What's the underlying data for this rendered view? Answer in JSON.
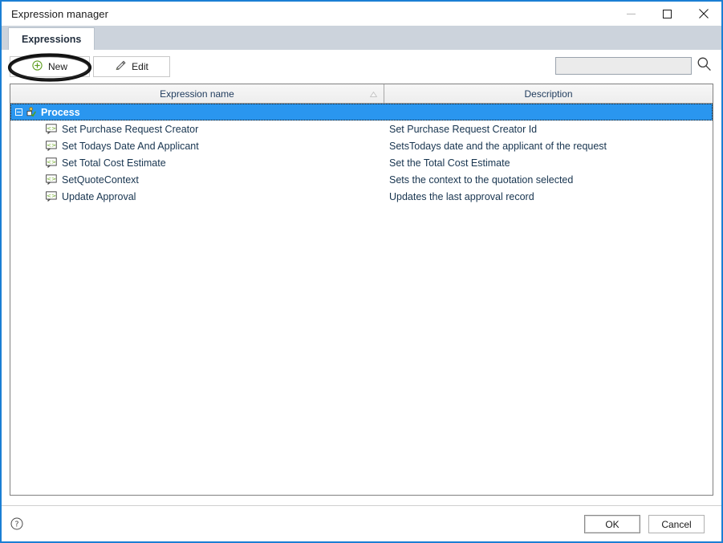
{
  "window": {
    "title": "Expression manager",
    "controls": {
      "minimize": "minimize-button",
      "maximize": "maximize-button",
      "close": "close-button"
    }
  },
  "tabs": [
    {
      "label": "Expressions",
      "active": true
    }
  ],
  "toolbar": {
    "new_label": "New",
    "edit_label": "Edit",
    "new_icon": "plus-circle-icon",
    "edit_icon": "pencil-icon",
    "highlight": "hand-drawn-ellipse-around-new-button"
  },
  "search": {
    "value": "",
    "placeholder": "",
    "icon": "search-icon"
  },
  "grid": {
    "columns": [
      {
        "key": "name",
        "label": "Expression name",
        "sort": "ascending"
      },
      {
        "key": "description",
        "label": "Description",
        "sort": ""
      }
    ],
    "group": {
      "label": "Process",
      "expanded": true,
      "selected": true,
      "icon": "process-check-icon",
      "expander_icon": "minus-box-icon"
    },
    "rows": [
      {
        "icon": "expression-bubble-icon",
        "name": "Set Purchase Request Creator",
        "description": "Set Purchase Request Creator  Id"
      },
      {
        "icon": "expression-bubble-icon",
        "name": "Set Todays Date And Applicant",
        "description": "SetsTodays date and the applicant of the request"
      },
      {
        "icon": "expression-bubble-icon",
        "name": "Set Total Cost Estimate",
        "description": "Set the Total Cost Estimate"
      },
      {
        "icon": "expression-bubble-icon",
        "name": "SetQuoteContext",
        "description": "Sets the context to the quotation selected"
      },
      {
        "icon": "expression-bubble-icon",
        "name": "Update Approval",
        "description": "Updates the last approval record"
      }
    ]
  },
  "footer": {
    "help_icon": "help-circle-icon",
    "ok_label": "OK",
    "cancel_label": "Cancel"
  },
  "colors": {
    "window_border": "#1b7fd4",
    "selection": "#2a96ef",
    "tabstrip": "#ccd3dc",
    "header": "#f0f0f0",
    "text": "#17344f",
    "icon_green": "#6aa81e"
  }
}
